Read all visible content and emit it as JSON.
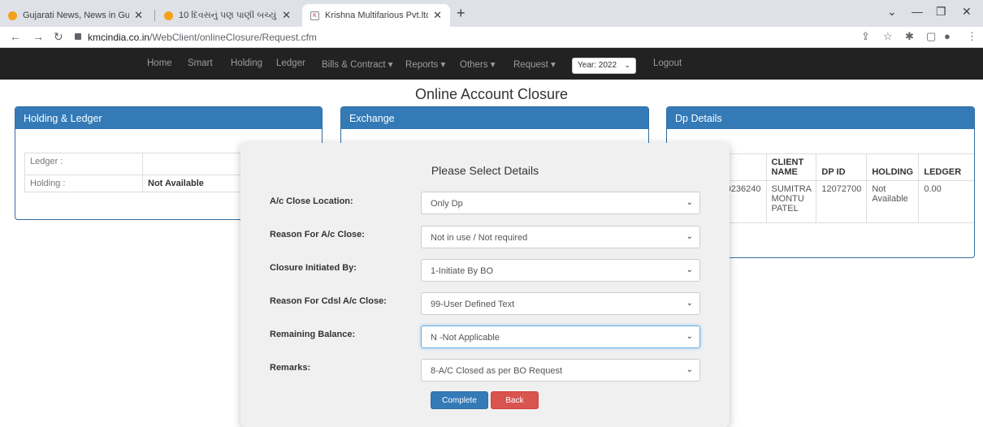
{
  "browser": {
    "tabs": [
      {
        "title": "Gujarati News, News in Gujarati -",
        "close": "✕"
      },
      {
        "title": "10 દિવસનું પણ પાણી બચ્યું નથી, વો",
        "close": "✕"
      },
      {
        "title": "Krishna Multifarious Pvt.ltd Clien",
        "close": "✕"
      }
    ],
    "new_tab": "+",
    "url_host": "kmcindia.co.in",
    "url_path": "/WebClient/onlineClosure/Request.cfm"
  },
  "navbar": {
    "items": [
      "Home",
      "Smart",
      "Holding",
      "Ledger",
      "Bills & Contract ▾",
      "Reports ▾",
      "Others ▾",
      "Request ▾"
    ],
    "year": "Year: 2022",
    "logout": "Logout"
  },
  "page": {
    "title": "Online Account Closure"
  },
  "holding_panel": {
    "heading": "Holding & Ledger",
    "rows": [
      {
        "label": "Ledger :",
        "value": ""
      },
      {
        "label": "Holding :",
        "value": "Not Available"
      }
    ]
  },
  "exchange_panel": {
    "heading": "Exchange"
  },
  "dp_panel": {
    "heading": "Dp Details",
    "columns": [
      "CLIENT NAME",
      "DP ID",
      "HOLDING",
      "LEDGER"
    ],
    "row": {
      "client_code": "0000236240",
      "client_name": "SUMITRA MONTU PATEL",
      "dp_id": "12072700",
      "holding": "Not Available",
      "ledger": "0.00"
    }
  },
  "modal": {
    "title": "Please Select Details",
    "fields": [
      {
        "label": "A/c Close Location:",
        "value": "Only Dp"
      },
      {
        "label": "Reason For A/c Close:",
        "value": "Not in use / Not required"
      },
      {
        "label": "Closure Initiated By:",
        "value": "1-Initiate By BO"
      },
      {
        "label": "Reason For Cdsl A/c Close:",
        "value": "99-User Defined Text"
      },
      {
        "label": "Remaining Balance:",
        "value": "N -Not Applicable"
      },
      {
        "label": "Remarks:",
        "value": "8-A/C Closed as per BO Request"
      }
    ],
    "complete_label": "Complete",
    "back_label": "Back"
  }
}
